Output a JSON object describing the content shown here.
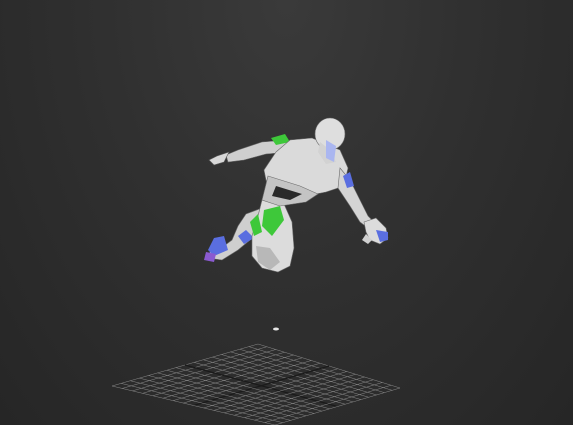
{
  "viewport": {
    "background_color": "#303030",
    "grid_color": "#8a8a8a",
    "grid_axis_color": "#1a1a1a",
    "character_body_color": "#d8d8d8",
    "character_shadow_color": "#9a9a9a",
    "marker_green": "#3ec83a",
    "marker_blue": "#5a6ee0",
    "marker_purple": "#8a5ad0"
  },
  "scene": {
    "object": "biped-figure",
    "pose": "mid-air leap"
  }
}
